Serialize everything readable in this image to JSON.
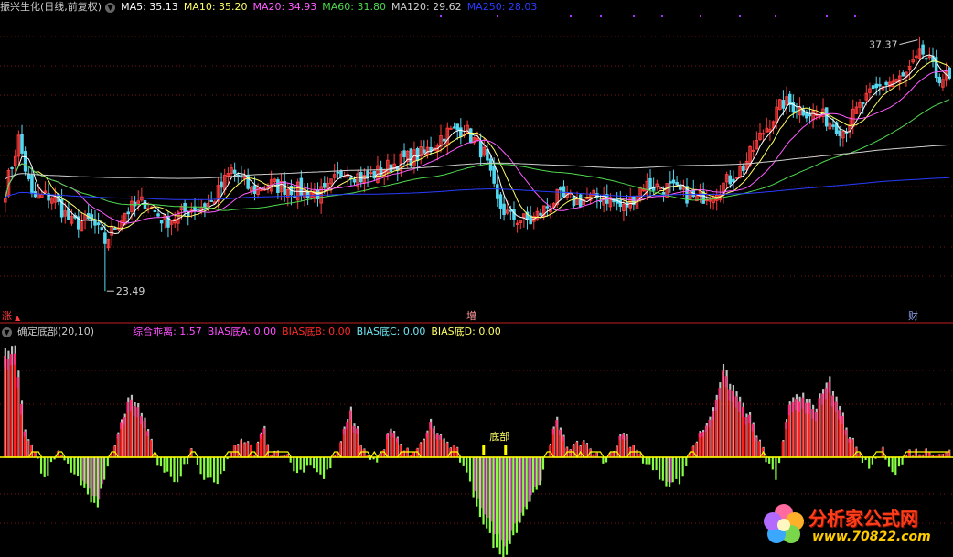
{
  "colors": {
    "background": "#000000",
    "up": "#ff3c3c",
    "down": "#54d8f0",
    "grid": "#7a1414",
    "divider": "#c02020",
    "ma5": "#ffffff",
    "ma10": "#ffff66",
    "ma20": "#ff5cff",
    "ma60": "#4fd94f",
    "ma120": "#cfcfcf",
    "ma250": "#2a3cff",
    "bias_a": "#e0e0e0",
    "bias_b": "#ff2a2a",
    "bias_c": "#6de5f0",
    "bias_d": "#ffff66",
    "combined": "#ff4fff",
    "baseline": "#ffff00",
    "hist_pos": "#ff2020",
    "hist_neg": "#88ff44",
    "hist_neg_accent": "#d020d0",
    "hist_pos_accent": "#ff2a7a",
    "hist_shadow": "#bfbfbf"
  },
  "main_header": {
    "title": "振兴生化(日线,前复权)",
    "items": [
      {
        "label": "MA5: 35.13",
        "color": "#ffffff"
      },
      {
        "label": "MA10: 35.20",
        "color": "#ffff66"
      },
      {
        "label": "MA20: 34.93",
        "color": "#ff5cff"
      },
      {
        "label": "MA60: 31.80",
        "color": "#4fd94f"
      },
      {
        "label": "MA120: 29.62",
        "color": "#cfcfcf"
      },
      {
        "label": "MA250: 28.03",
        "color": "#2a3cff"
      }
    ]
  },
  "sub_header": {
    "title": "确定底部(20,10)",
    "items": [
      {
        "label": "综合乖离: 1.57",
        "color": "#ff4fff"
      },
      {
        "label": "BIAS底A: 0.00",
        "color": "#ff4fff"
      },
      {
        "label": "BIAS底B: 0.00",
        "color": "#ff2a2a"
      },
      {
        "label": "BIAS底C: 0.00",
        "color": "#6de5f0"
      },
      {
        "label": "BIAS底D: 0.00",
        "color": "#ffff66"
      }
    ]
  },
  "annotations": {
    "high_label": "37.37",
    "low_label": "23.49",
    "bottom_label": "底部"
  },
  "event_markers": [
    {
      "text": "涨",
      "color": "#ff3c3c"
    },
    {
      "text": "增",
      "color": "#ff9a9a"
    },
    {
      "text": "财",
      "color": "#9ab0ff"
    }
  ],
  "watermark": {
    "text": "分析家公式网",
    "url": "www.70822.com"
  },
  "chart_data": [
    {
      "type": "candlestick",
      "title": "振兴生化(日线,前复权)",
      "ylim": [
        22.5,
        38.5
      ],
      "price_high": 37.37,
      "price_low": 23.49,
      "close_anchors": [
        [
          0,
          29.0
        ],
        [
          4,
          31.8
        ],
        [
          8,
          28.6
        ],
        [
          14,
          28.7
        ],
        [
          20,
          27.2
        ],
        [
          26,
          27.3
        ],
        [
          30,
          26.2
        ],
        [
          36,
          27.8
        ],
        [
          42,
          28.4
        ],
        [
          48,
          27.3
        ],
        [
          56,
          28.0
        ],
        [
          62,
          28.3
        ],
        [
          68,
          30.1
        ],
        [
          74,
          29.0
        ],
        [
          80,
          29.3
        ],
        [
          88,
          29.0
        ],
        [
          96,
          28.8
        ],
        [
          102,
          30.2
        ],
        [
          108,
          29.6
        ],
        [
          114,
          30.2
        ],
        [
          120,
          30.7
        ],
        [
          126,
          31.0
        ],
        [
          132,
          32.1
        ],
        [
          138,
          32.4
        ],
        [
          144,
          31.0
        ],
        [
          148,
          28.3
        ],
        [
          152,
          27.5
        ],
        [
          158,
          27.3
        ],
        [
          166,
          28.6
        ],
        [
          172,
          28.4
        ],
        [
          180,
          28.7
        ],
        [
          186,
          28.0
        ],
        [
          192,
          29.3
        ],
        [
          200,
          29.1
        ],
        [
          208,
          28.5
        ],
        [
          216,
          29.3
        ],
        [
          222,
          30.3
        ],
        [
          228,
          32.2
        ],
        [
          234,
          33.8
        ],
        [
          240,
          33.4
        ],
        [
          246,
          33.0
        ],
        [
          252,
          32.3
        ],
        [
          258,
          33.8
        ],
        [
          264,
          34.8
        ],
        [
          270,
          35.1
        ],
        [
          276,
          36.5
        ],
        [
          280,
          35.3
        ],
        [
          284,
          35.1
        ]
      ],
      "ma_latest": {
        "MA5": 35.13,
        "MA10": 35.2,
        "MA20": 34.93,
        "MA60": 31.8,
        "MA120": 29.62,
        "MA250": 28.03
      }
    },
    {
      "type": "bar",
      "title": "确定底部(20,10)",
      "series_latest": {
        "综合乖离": 1.57,
        "BIAS底A": 0.0,
        "BIAS底B": 0.0,
        "BIAS底C": 0.0,
        "BIAS底D": 0.0
      },
      "hist_anchors": [
        [
          0,
          0.9
        ],
        [
          3,
          0.95
        ],
        [
          6,
          0.25
        ],
        [
          9,
          0.05
        ],
        [
          12,
          -0.2
        ],
        [
          16,
          0.05
        ],
        [
          20,
          -0.1
        ],
        [
          24,
          -0.3
        ],
        [
          28,
          -0.45
        ],
        [
          32,
          0.05
        ],
        [
          38,
          0.55
        ],
        [
          42,
          0.3
        ],
        [
          46,
          -0.05
        ],
        [
          52,
          -0.25
        ],
        [
          56,
          0.05
        ],
        [
          60,
          -0.2
        ],
        [
          64,
          -0.25
        ],
        [
          68,
          0.05
        ],
        [
          72,
          0.15
        ],
        [
          75,
          0.05
        ],
        [
          78,
          0.25
        ],
        [
          80,
          0.05
        ],
        [
          84,
          0.05
        ],
        [
          88,
          -0.15
        ],
        [
          92,
          -0.05
        ],
        [
          96,
          -0.2
        ],
        [
          100,
          0.05
        ],
        [
          104,
          0.4
        ],
        [
          108,
          0.05
        ],
        [
          112,
          -0.05
        ],
        [
          116,
          0.25
        ],
        [
          120,
          0.05
        ],
        [
          124,
          0.05
        ],
        [
          128,
          0.3
        ],
        [
          132,
          0.15
        ],
        [
          136,
          0.05
        ],
        [
          140,
          -0.25
        ],
        [
          144,
          -0.6
        ],
        [
          148,
          -0.85
        ],
        [
          150,
          -0.92
        ],
        [
          154,
          -0.65
        ],
        [
          158,
          -0.4
        ],
        [
          162,
          -0.15
        ],
        [
          166,
          0.35
        ],
        [
          170,
          0.05
        ],
        [
          174,
          0.15
        ],
        [
          180,
          -0.05
        ],
        [
          186,
          0.2
        ],
        [
          190,
          0.05
        ],
        [
          196,
          -0.15
        ],
        [
          200,
          -0.25
        ],
        [
          204,
          -0.2
        ],
        [
          206,
          0.05
        ],
        [
          212,
          0.35
        ],
        [
          216,
          0.75
        ],
        [
          220,
          0.55
        ],
        [
          224,
          0.35
        ],
        [
          228,
          0.05
        ],
        [
          232,
          -0.2
        ],
        [
          236,
          0.45
        ],
        [
          240,
          0.55
        ],
        [
          244,
          0.45
        ],
        [
          248,
          0.65
        ],
        [
          252,
          0.35
        ],
        [
          256,
          0.05
        ],
        [
          260,
          -0.1
        ],
        [
          264,
          0.05
        ],
        [
          268,
          -0.15
        ],
        [
          272,
          0.05
        ]
      ]
    }
  ]
}
